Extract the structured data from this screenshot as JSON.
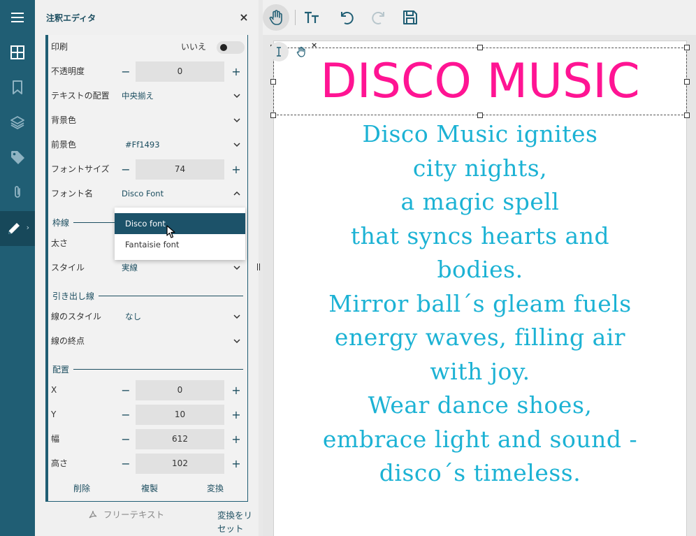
{
  "panel": {
    "title": "注釈エディタ",
    "close_label": "×"
  },
  "props": {
    "print": {
      "label": "印刷",
      "value": "いいえ"
    },
    "opacity": {
      "label": "不透明度",
      "value": "0"
    },
    "text_align": {
      "label": "テキストの配置",
      "value": "中央揃え"
    },
    "bg_color": {
      "label": "背景色",
      "value": ""
    },
    "fg_color": {
      "label": "前景色",
      "value": "#Ff1493"
    },
    "font_size": {
      "label": "フォントサイズ",
      "value": "74"
    },
    "font_name": {
      "label": "フォント名",
      "value": "Disco Font"
    },
    "border_section": "枠線",
    "thickness": {
      "label": "太さ"
    },
    "style": {
      "label": "スタイル",
      "value": "実線"
    },
    "leader_section": "引き出し線",
    "line_style": {
      "label": "線のスタイル",
      "value": "なし"
    },
    "line_end": {
      "label": "線の終点",
      "value": ""
    },
    "placement_section": "配置",
    "x": {
      "label": "X",
      "value": "0"
    },
    "y": {
      "label": "Y",
      "value": "10"
    },
    "width": {
      "label": "幅",
      "value": "612"
    },
    "height": {
      "label": "高さ",
      "value": "102"
    },
    "actions": {
      "delete": "削除",
      "duplicate": "複製",
      "transform": "変換"
    }
  },
  "dropdown": {
    "options": [
      "Disco font",
      "Fantaisie font"
    ],
    "selected_index": 0
  },
  "footer": {
    "free_text": "フリーテキスト",
    "reset_transform": "変換をリセット"
  },
  "document": {
    "title": "DISCO MUSIC",
    "poem_lines": [
      "Disco Music ignites",
      "city nights,",
      "a magic spell",
      "that syncs hearts and",
      "bodies.",
      "Mirror ball´s gleam fuels",
      "energy waves, filling air",
      "with joy.",
      "Wear dance shoes,",
      "embrace light and sound -",
      "disco´s timeless."
    ]
  },
  "colors": {
    "accent": "#205e74",
    "title_color": "#ff1493",
    "poem_color": "#1cb2d4"
  },
  "icons": {
    "rail": [
      "menu-icon",
      "thumbnails-icon",
      "bookmark-icon",
      "layers-icon",
      "tag-icon",
      "attachment-icon",
      "annotation-edit-icon"
    ],
    "toolbar": [
      "pan-hand-icon",
      "text-size-icon",
      "undo-icon",
      "redo-icon",
      "save-icon"
    ]
  }
}
